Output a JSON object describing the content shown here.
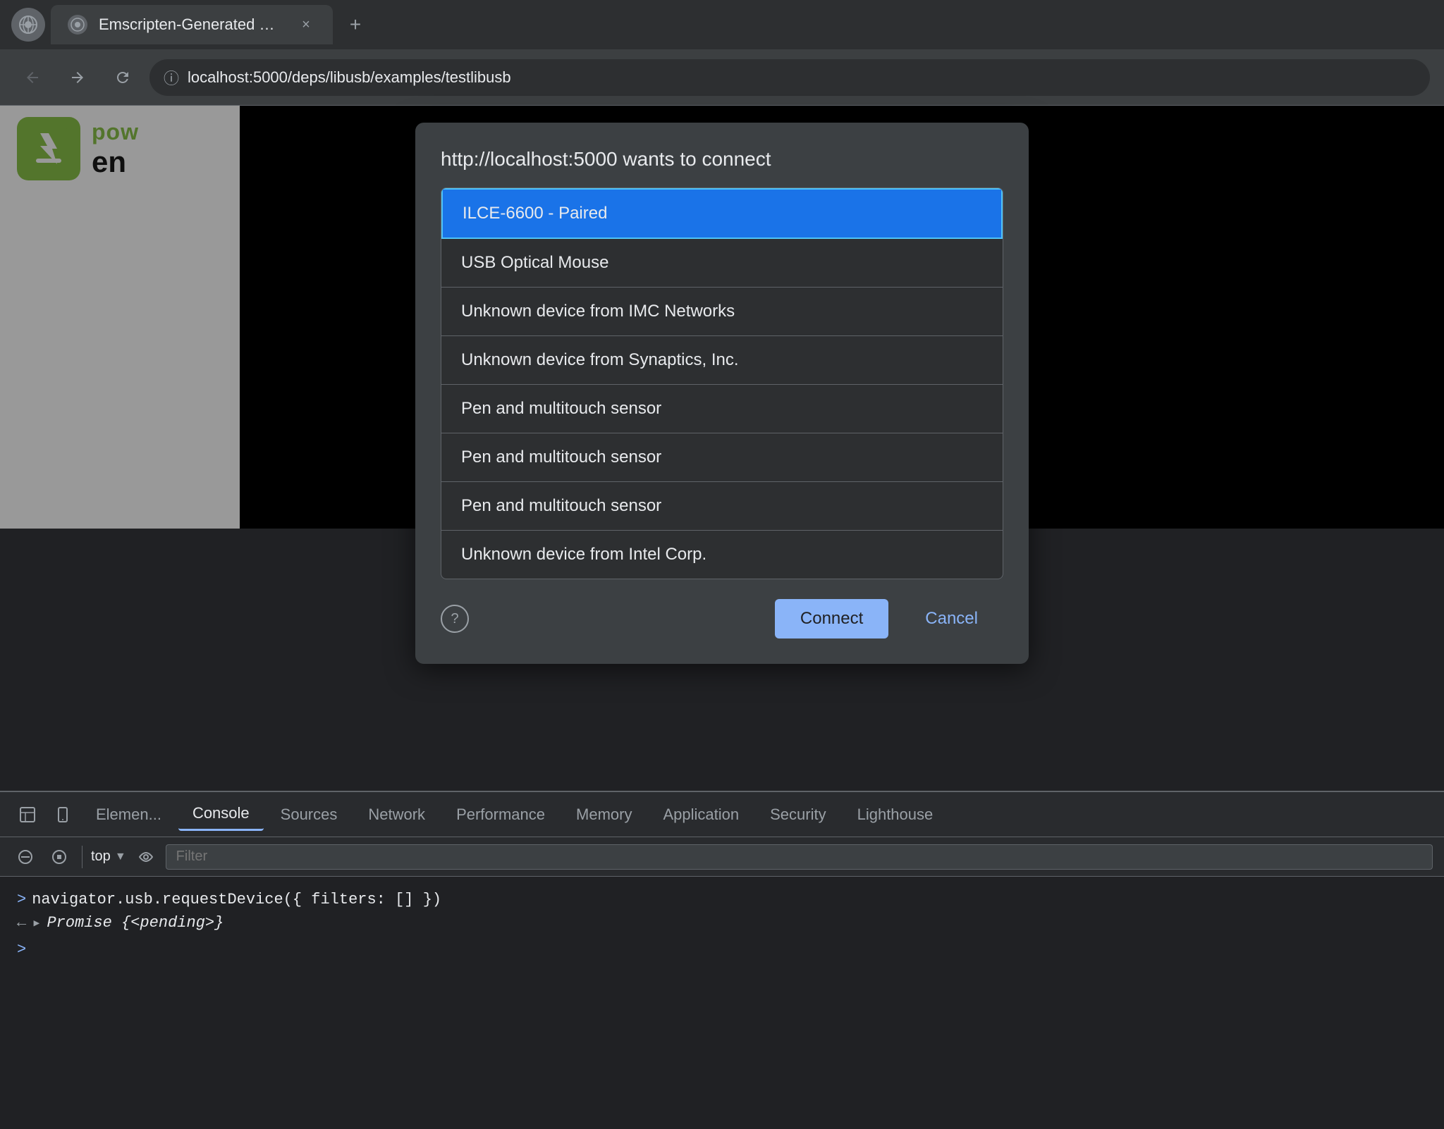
{
  "browser": {
    "tab_title": "Emscripten-Generated Code",
    "url": "localhost:5000/deps/libusb/examples/testlibusb",
    "new_tab_label": "+",
    "close_tab_label": "×"
  },
  "dialog": {
    "title": "http://localhost:5000 wants to connect",
    "devices": [
      {
        "id": "device-0",
        "label": "ILCE-6600 - Paired",
        "selected": true
      },
      {
        "id": "device-1",
        "label": "USB Optical Mouse",
        "selected": false
      },
      {
        "id": "device-2",
        "label": "Unknown device from IMC Networks",
        "selected": false
      },
      {
        "id": "device-3",
        "label": "Unknown device from Synaptics, Inc.",
        "selected": false
      },
      {
        "id": "device-4",
        "label": "Pen and multitouch sensor",
        "selected": false
      },
      {
        "id": "device-5",
        "label": "Pen and multitouch sensor",
        "selected": false
      },
      {
        "id": "device-6",
        "label": "Pen and multitouch sensor",
        "selected": false
      },
      {
        "id": "device-7",
        "label": "Unknown device from Intel Corp.",
        "selected": false
      }
    ],
    "connect_label": "Connect",
    "cancel_label": "Cancel"
  },
  "devtools": {
    "tabs": [
      {
        "id": "elements",
        "label": "Elemen..."
      },
      {
        "id": "console",
        "label": "Console",
        "active": true
      },
      {
        "id": "sources",
        "label": "Sources"
      },
      {
        "id": "network",
        "label": "Network"
      },
      {
        "id": "performance",
        "label": "Performance"
      },
      {
        "id": "memory",
        "label": "Memory"
      },
      {
        "id": "application",
        "label": "Application"
      },
      {
        "id": "security",
        "label": "Security"
      },
      {
        "id": "lighthouse",
        "label": "Lighthouse"
      }
    ],
    "top_label": "top",
    "filter_placeholder": "Filter",
    "console_lines": [
      {
        "type": "input",
        "prompt": ">",
        "code": "navigator.usb.requestDevice({ filters: [] })"
      },
      {
        "type": "result",
        "back_arrow": "←",
        "triangle": "▶",
        "italic_text": "Promise {<pending>}"
      }
    ]
  },
  "logo": {
    "pow": "pow",
    "en": "en"
  }
}
